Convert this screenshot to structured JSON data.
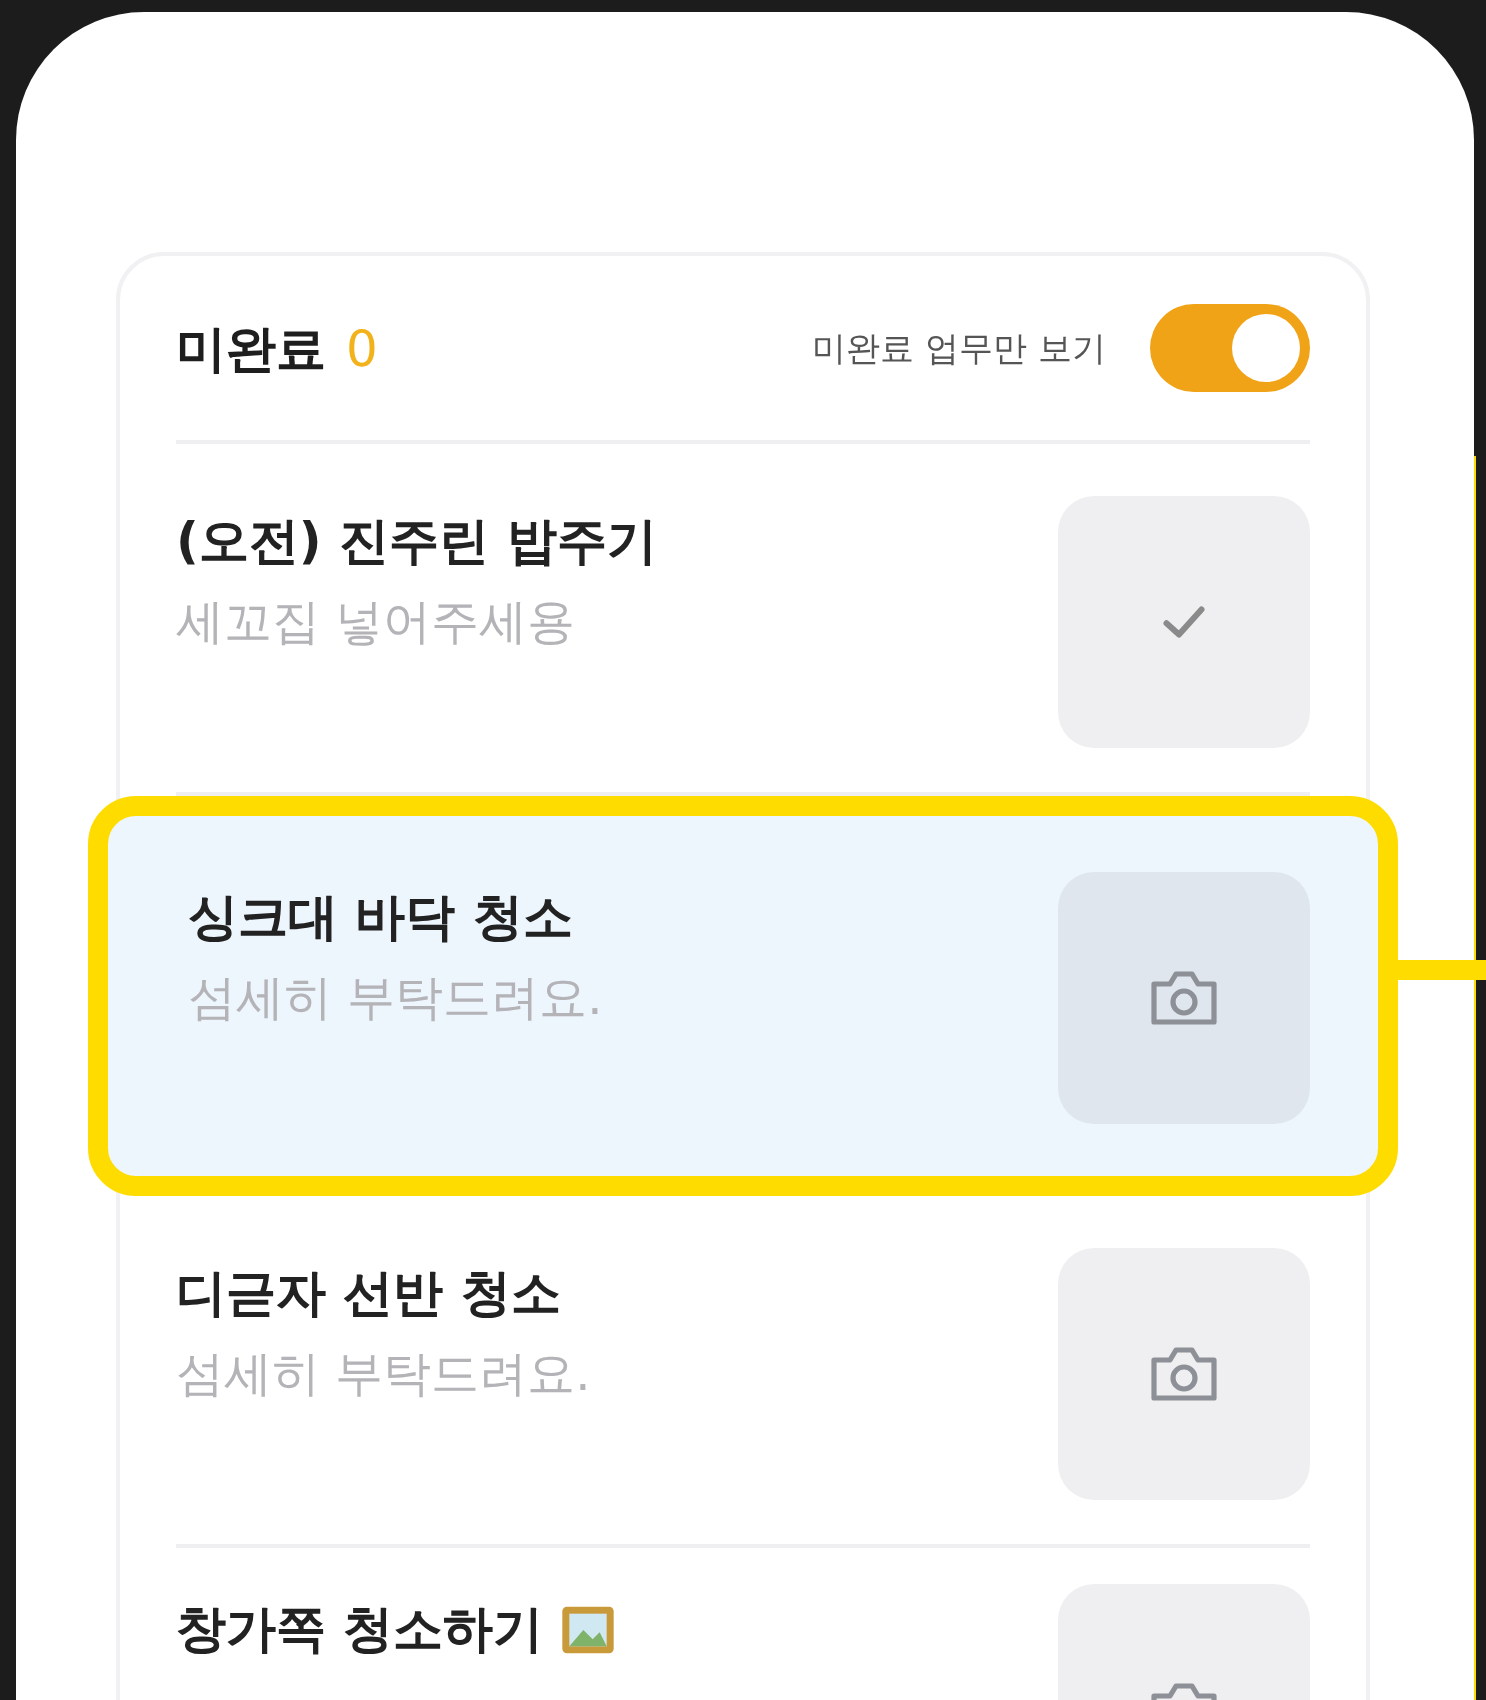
{
  "header": {
    "title": "미완료",
    "count": "0",
    "filter_label": "미완료 업무만 보기",
    "filter_on": true
  },
  "tasks": [
    {
      "title": "(오전) 진주린 밥주기",
      "note": "세꼬집 넣어주세용",
      "kind": "check",
      "highlighted": false
    },
    {
      "title": "싱크대 바닥 청소",
      "note": "섬세히 부탁드려요.",
      "kind": "photo",
      "highlighted": true
    },
    {
      "title": "디귿자 선반 청소",
      "note": "섬세히 부탁드려요.",
      "kind": "photo",
      "highlighted": false
    },
    {
      "title": "창가쪽 청소하기",
      "kind": "photo",
      "highlighted": false,
      "picture_icon": true
    }
  ]
}
